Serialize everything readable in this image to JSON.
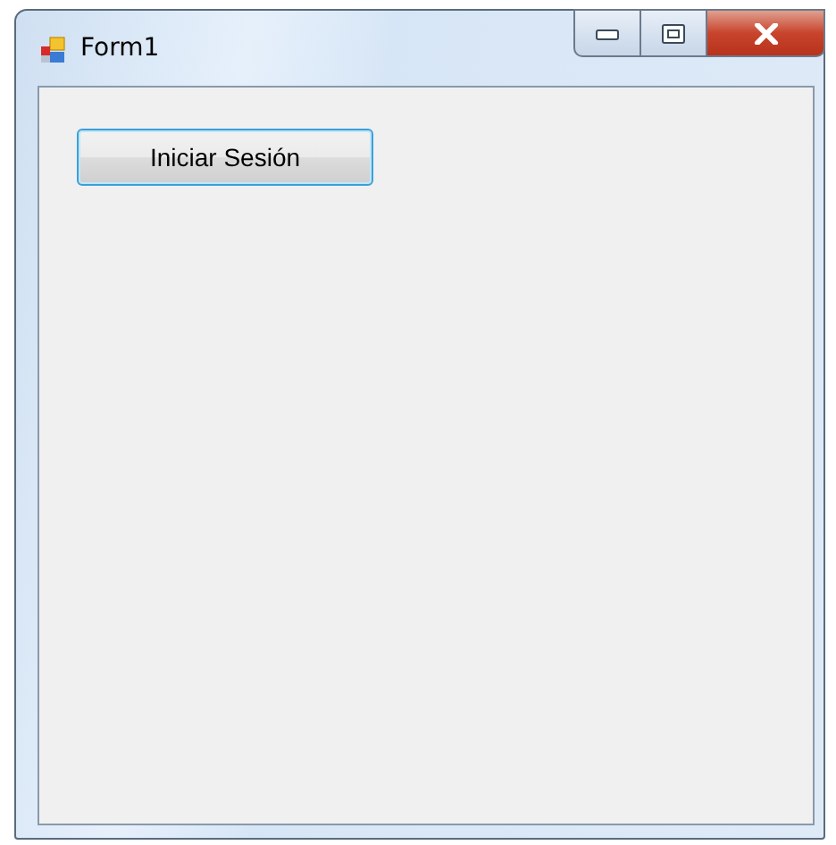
{
  "window": {
    "title": "Form1"
  },
  "buttons": [
    {
      "label": "Iniciar Sesión"
    }
  ]
}
